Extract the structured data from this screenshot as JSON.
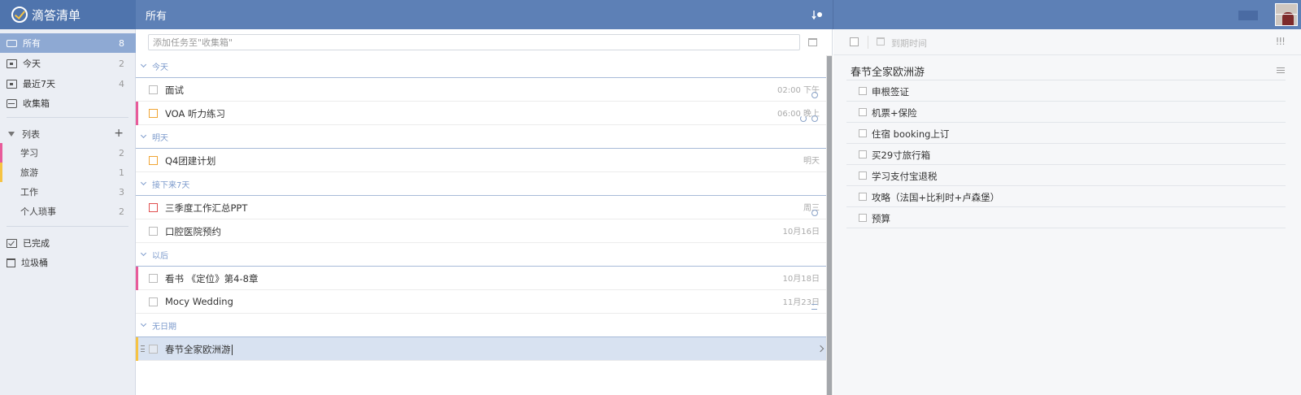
{
  "app": {
    "name": "滴答清单"
  },
  "header": {
    "title": "所有"
  },
  "sidebar": {
    "smart": [
      {
        "label": "所有",
        "count": "8"
      },
      {
        "label": "今天",
        "count": "2"
      },
      {
        "label": "最近7天",
        "count": "4"
      },
      {
        "label": "收集箱",
        "count": ""
      }
    ],
    "lists_header": "列表",
    "lists": [
      {
        "label": "学习",
        "count": "2",
        "color": "#e85b9a"
      },
      {
        "label": "旅游",
        "count": "1",
        "color": "#f6c343"
      },
      {
        "label": "工作",
        "count": "3",
        "color": ""
      },
      {
        "label": "个人琐事",
        "count": "2",
        "color": ""
      }
    ],
    "bottom": [
      {
        "label": "已完成"
      },
      {
        "label": "垃圾桶"
      }
    ]
  },
  "main": {
    "add_placeholder": "添加任务至\"收集箱\"",
    "groups": [
      "今天",
      "明天",
      "接下来7天",
      "以后",
      "无日期"
    ],
    "tasks": [
      {
        "title": "面试",
        "date": "02:00 下午"
      },
      {
        "title": "VOA 听力练习",
        "date": "06:00 晚上"
      },
      {
        "title": "Q4团建计划",
        "date": "明天"
      },
      {
        "title": "三季度工作汇总PPT",
        "date": "周三"
      },
      {
        "title": "口腔医院预约",
        "date": "10月16日"
      },
      {
        "title": "看书 《定位》第4-8章",
        "date": "10月18日"
      },
      {
        "title": "Mocy Wedding",
        "date": "11月23日"
      },
      {
        "title": "春节全家欧洲游",
        "date": ""
      }
    ]
  },
  "detail": {
    "due_label": "到期时间",
    "priority": "!!!",
    "title": "春节全家欧洲游",
    "subtasks": [
      "申根签证",
      "机票+保险",
      "住宿 booking上订",
      "买29寸旅行箱",
      "学习支付宝退税",
      "攻略（法国+比利时+卢森堡）",
      "预算"
    ]
  },
  "colors": {
    "header": "#5d80b6",
    "sidebar_active": "#8ea9d3",
    "priority_high": "#e04f4f",
    "priority_med": "#f0a534",
    "study": "#e85b9a",
    "travel": "#f6c343"
  }
}
